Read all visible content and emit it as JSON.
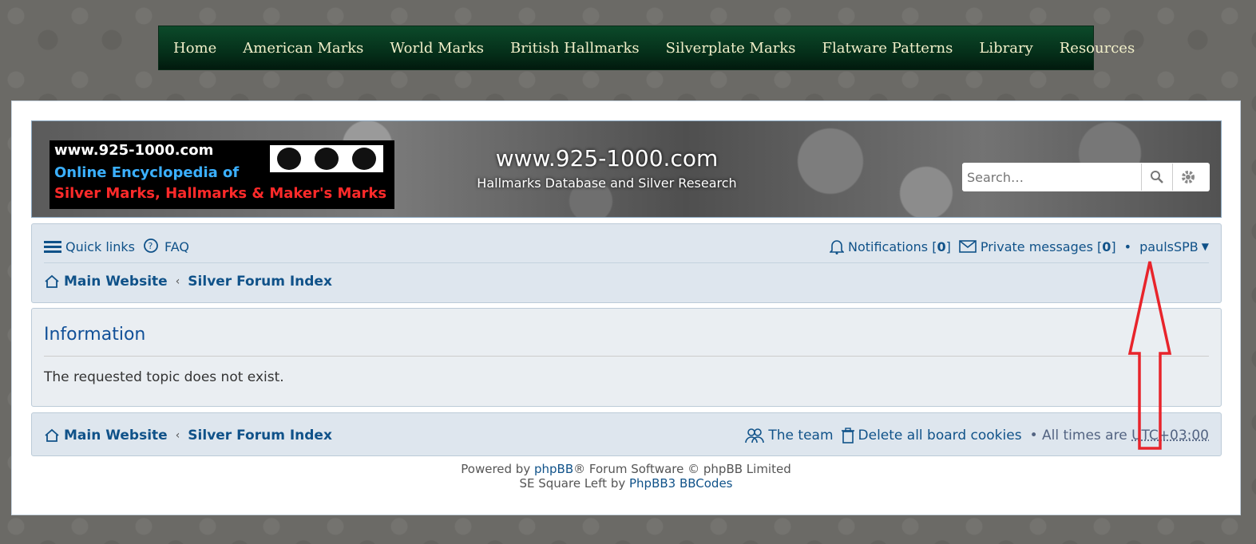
{
  "topnav": [
    "Home",
    "American Marks",
    "World Marks",
    "British Hallmarks",
    "Silverplate Marks",
    "Flatware Patterns",
    "Library",
    "Resources"
  ],
  "header": {
    "logo_line1": "www.925-1000.com",
    "logo_line2": "Online Encyclopedia of",
    "logo_line3": "Silver Marks, Hallmarks & Maker's Marks",
    "site_title": "www.925-1000.com",
    "site_desc": "Hallmarks Database and Silver Research",
    "search_placeholder": "Search…"
  },
  "navbar": {
    "quick_links": "Quick links",
    "faq": "FAQ",
    "notifications_label": "Notifications",
    "notifications_count": "0",
    "pm_label": "Private messages",
    "pm_count": "0",
    "username": "paulsSPB",
    "crumb1": "Main Website",
    "crumb2": "Silver Forum Index"
  },
  "info": {
    "title": "Information",
    "message": "The requested topic does not exist."
  },
  "footer": {
    "crumb1": "Main Website",
    "crumb2": "Silver Forum Index",
    "team": "The team",
    "delete_cookies": "Delete all board cookies",
    "times_prefix": "All times are",
    "timezone": "UTC+03:00",
    "powered_prefix": "Powered by",
    "phpbb": "phpBB",
    "powered_suffix": "® Forum Software © phpBB Limited",
    "style_prefix": "SE Square Left by",
    "style_link": "PhpBB3 BBCodes"
  },
  "colors": {
    "accent": "#105289",
    "annotation_arrow": "#e8242b"
  }
}
